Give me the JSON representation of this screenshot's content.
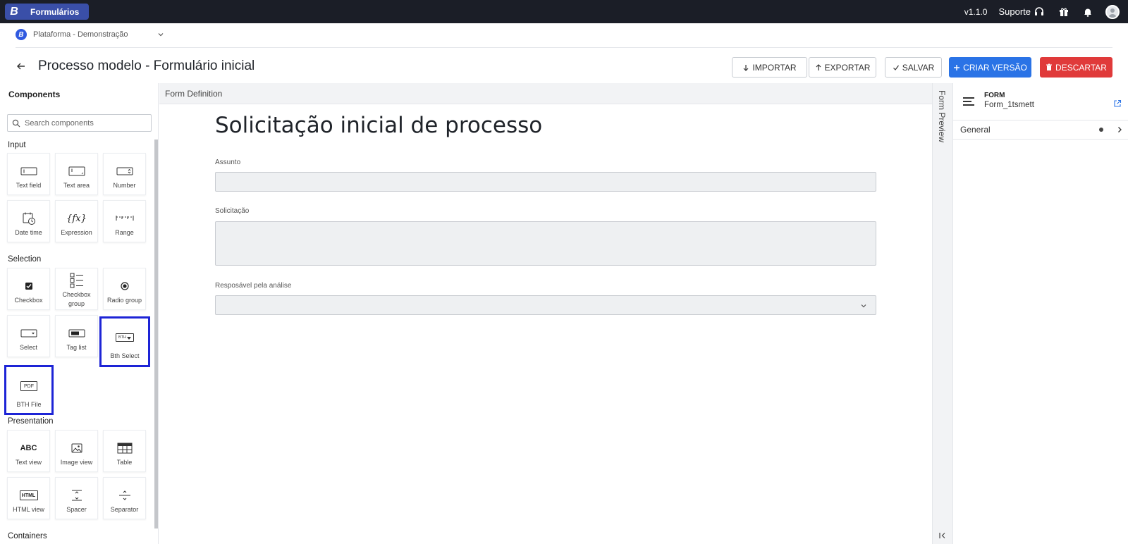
{
  "topbar": {
    "brand_letter": "B",
    "app_name": "Formulários",
    "version": "v1.1.0",
    "support_label": "Suporte"
  },
  "platform": {
    "logo_letter": "B",
    "name": "Plataforma - Demonstração"
  },
  "header": {
    "title": "Processo modelo - Formulário inicial",
    "buttons": {
      "import": "IMPORTAR",
      "export": "EXPORTAR",
      "save": "SALVAR",
      "create_version": "CRIAR VERSÃO",
      "discard": "DESCARTAR"
    }
  },
  "components_panel": {
    "title": "Components",
    "search_placeholder": "Search components",
    "sections": {
      "input": "Input",
      "selection": "Selection",
      "presentation": "Presentation",
      "containers": "Containers"
    },
    "input_items": [
      "Text field",
      "Text area",
      "Number",
      "Date time",
      "Expression",
      "Range"
    ],
    "selection_items": [
      "Checkbox",
      "Checkbox group",
      "Radio group",
      "Select",
      "Tag list",
      "Bth Select",
      "BTH File"
    ],
    "presentation_items": [
      "Text view",
      "Image view",
      "Table",
      "HTML view",
      "Spacer",
      "Separator"
    ],
    "icon_text": {
      "abc": "ABC",
      "html": "HTML",
      "pdf": "PDF",
      "bth": "BTH",
      "fx": "{fx}"
    }
  },
  "canvas": {
    "header": "Form Definition",
    "form_title": "Solicitação inicial de processo",
    "fields": [
      {
        "label": "Assunto",
        "value": ""
      },
      {
        "label": "Solicitação",
        "value": ""
      },
      {
        "label": "Resposável pela análise",
        "value": ""
      }
    ]
  },
  "preview": {
    "label": "Form Preview"
  },
  "properties": {
    "caption": "FORM",
    "form_id": "Form_1tsmett",
    "general_label": "General"
  },
  "colors": {
    "topbar": "#1b1e27",
    "primary": "#2a73e6",
    "danger": "#e03a3a",
    "highlight": "#1d24d6"
  }
}
